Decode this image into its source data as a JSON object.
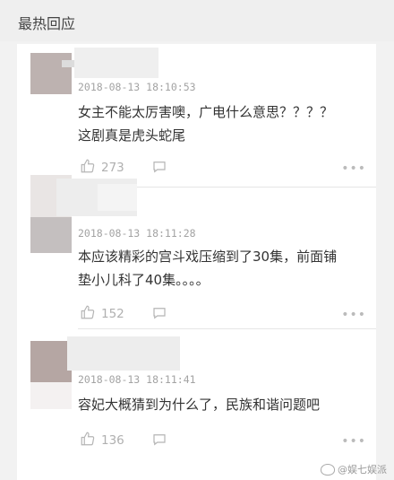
{
  "header": {
    "title": "最热回应"
  },
  "comments": [
    {
      "timestamp": "2018-08-13 18:10:53",
      "lines": [
        "女主不能太厉害噢，广电什么意思？？？？",
        "这剧真是虎头蛇尾"
      ],
      "likes": "273",
      "avatar_color": "#bdb2b0"
    },
    {
      "timestamp": "2018-08-13 18:11:28",
      "lines": [
        "本应该精彩的宫斗戏压缩到了30集，前面铺",
        "垫小儿科了40集。。。。"
      ],
      "likes": "152",
      "avatar_color": "#c4bfbf"
    },
    {
      "timestamp": "2018-08-13 18:11:41",
      "lines": [
        "容妃大概猜到为什么了，民族和谐问题吧"
      ],
      "likes": "136",
      "avatar_color": "#b5a6a3"
    }
  ],
  "watermark": "@娱七娱派"
}
